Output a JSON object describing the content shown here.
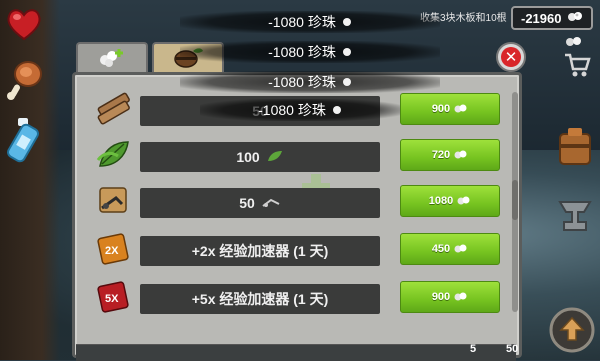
{
  "hud": {
    "quest_text": "收集3块木板和10根",
    "pearl_balance": "-21960"
  },
  "toasts": [
    {
      "text": "-1080 珍珠"
    },
    {
      "text": "-1080 珍珠"
    },
    {
      "text": "-1080 珍珠"
    },
    {
      "text": "-1080 珍珠"
    }
  ],
  "shop": {
    "tabs": [
      {
        "icon": "pearls-plus-icon"
      },
      {
        "icon": "barrel-leaf-icon"
      }
    ],
    "items": [
      {
        "icon": "wood-planks-icon",
        "amount": "50",
        "unit_icon": "",
        "price": "900"
      },
      {
        "icon": "leaves-icon",
        "amount": "100",
        "unit_icon": "leaf-icon",
        "price": "720"
      },
      {
        "icon": "scrap-crate-icon",
        "amount": "50",
        "unit_icon": "scrap-icon",
        "price": "1080"
      },
      {
        "icon": "xp-2x-icon",
        "amount": "+2x 经验加速器 (1 天)",
        "unit_icon": "",
        "price": "450"
      },
      {
        "icon": "xp-5x-icon",
        "amount": "+5x 经验加速器 (1 天)",
        "unit_icon": "",
        "price": "900"
      }
    ]
  },
  "bottom": {
    "count_a": "5",
    "count_b": "50"
  },
  "colors": {
    "buy_green": "#7fcf25",
    "close_red": "#d9262a",
    "bar_dark": "#3a3b3a"
  }
}
